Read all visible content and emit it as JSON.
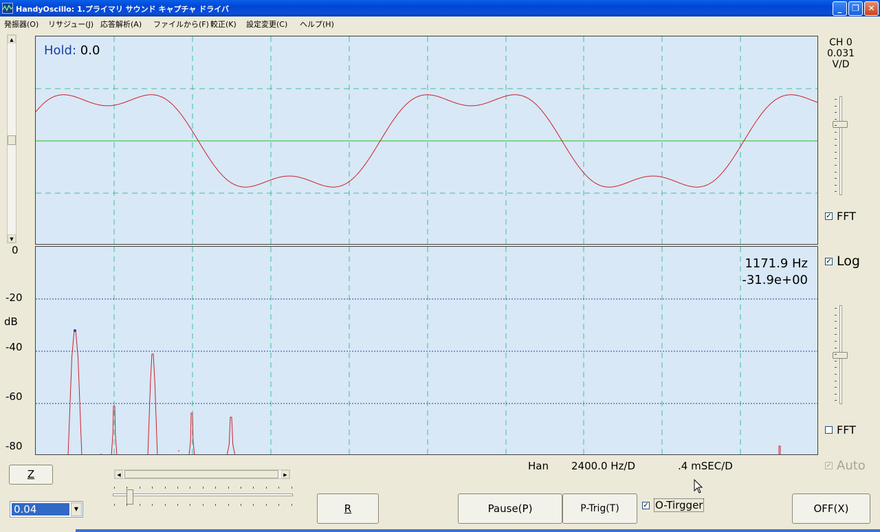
{
  "window": {
    "title": "HandyOscillo:  1.プライマリ サウンド キャプチャ ドライバ",
    "minimize_glyph": "_",
    "maximize_glyph": "❐",
    "close_glyph": "✕"
  },
  "menu": [
    "発振器(O)",
    "リサジュー(J)",
    "応答解析(A)",
    "ファイルから(F)",
    "較正(K)",
    "設定変更(C)",
    "ヘルプ(H)"
  ],
  "scope": {
    "hold_label": "Hold:",
    "hold_value": "0.0",
    "channel": "CH 0",
    "scale_value": "0.031",
    "scale_unit": "V/D"
  },
  "fft": {
    "freq_readout": "1171.9 Hz",
    "level_readout": "-31.9e+00",
    "db_axis_label": "dB",
    "db_ticks": [
      "0",
      "-20",
      "-40",
      "-60",
      "-80"
    ]
  },
  "checkboxes": {
    "fft_top": {
      "label": "FFT",
      "checked": true
    },
    "log": {
      "label": "Log",
      "checked": true
    },
    "fft_bottom": {
      "label": "FFT",
      "checked": false
    },
    "auto": {
      "label": "Auto",
      "checked": true,
      "disabled": true
    },
    "o_trigger": {
      "label": "O-Tirgger",
      "checked": true
    }
  },
  "status": {
    "window_fn": "Han",
    "freq_div": "2400.0 Hz/D",
    "time_div": ".4  mSEC/D"
  },
  "buttons": {
    "z": "Z",
    "r": "R",
    "pause": "Pause(P)",
    "ptrig": "P-Trig(T)",
    "off": "OFF(X)"
  },
  "gain_select": {
    "value": "0.04"
  },
  "colors": {
    "plot_bg": "#d8e8f6",
    "grid_dash": "#3fbf9a",
    "trace": "#cc1f2c",
    "zero_line": "#20c020",
    "db_grid": "#2a3f9a"
  }
}
